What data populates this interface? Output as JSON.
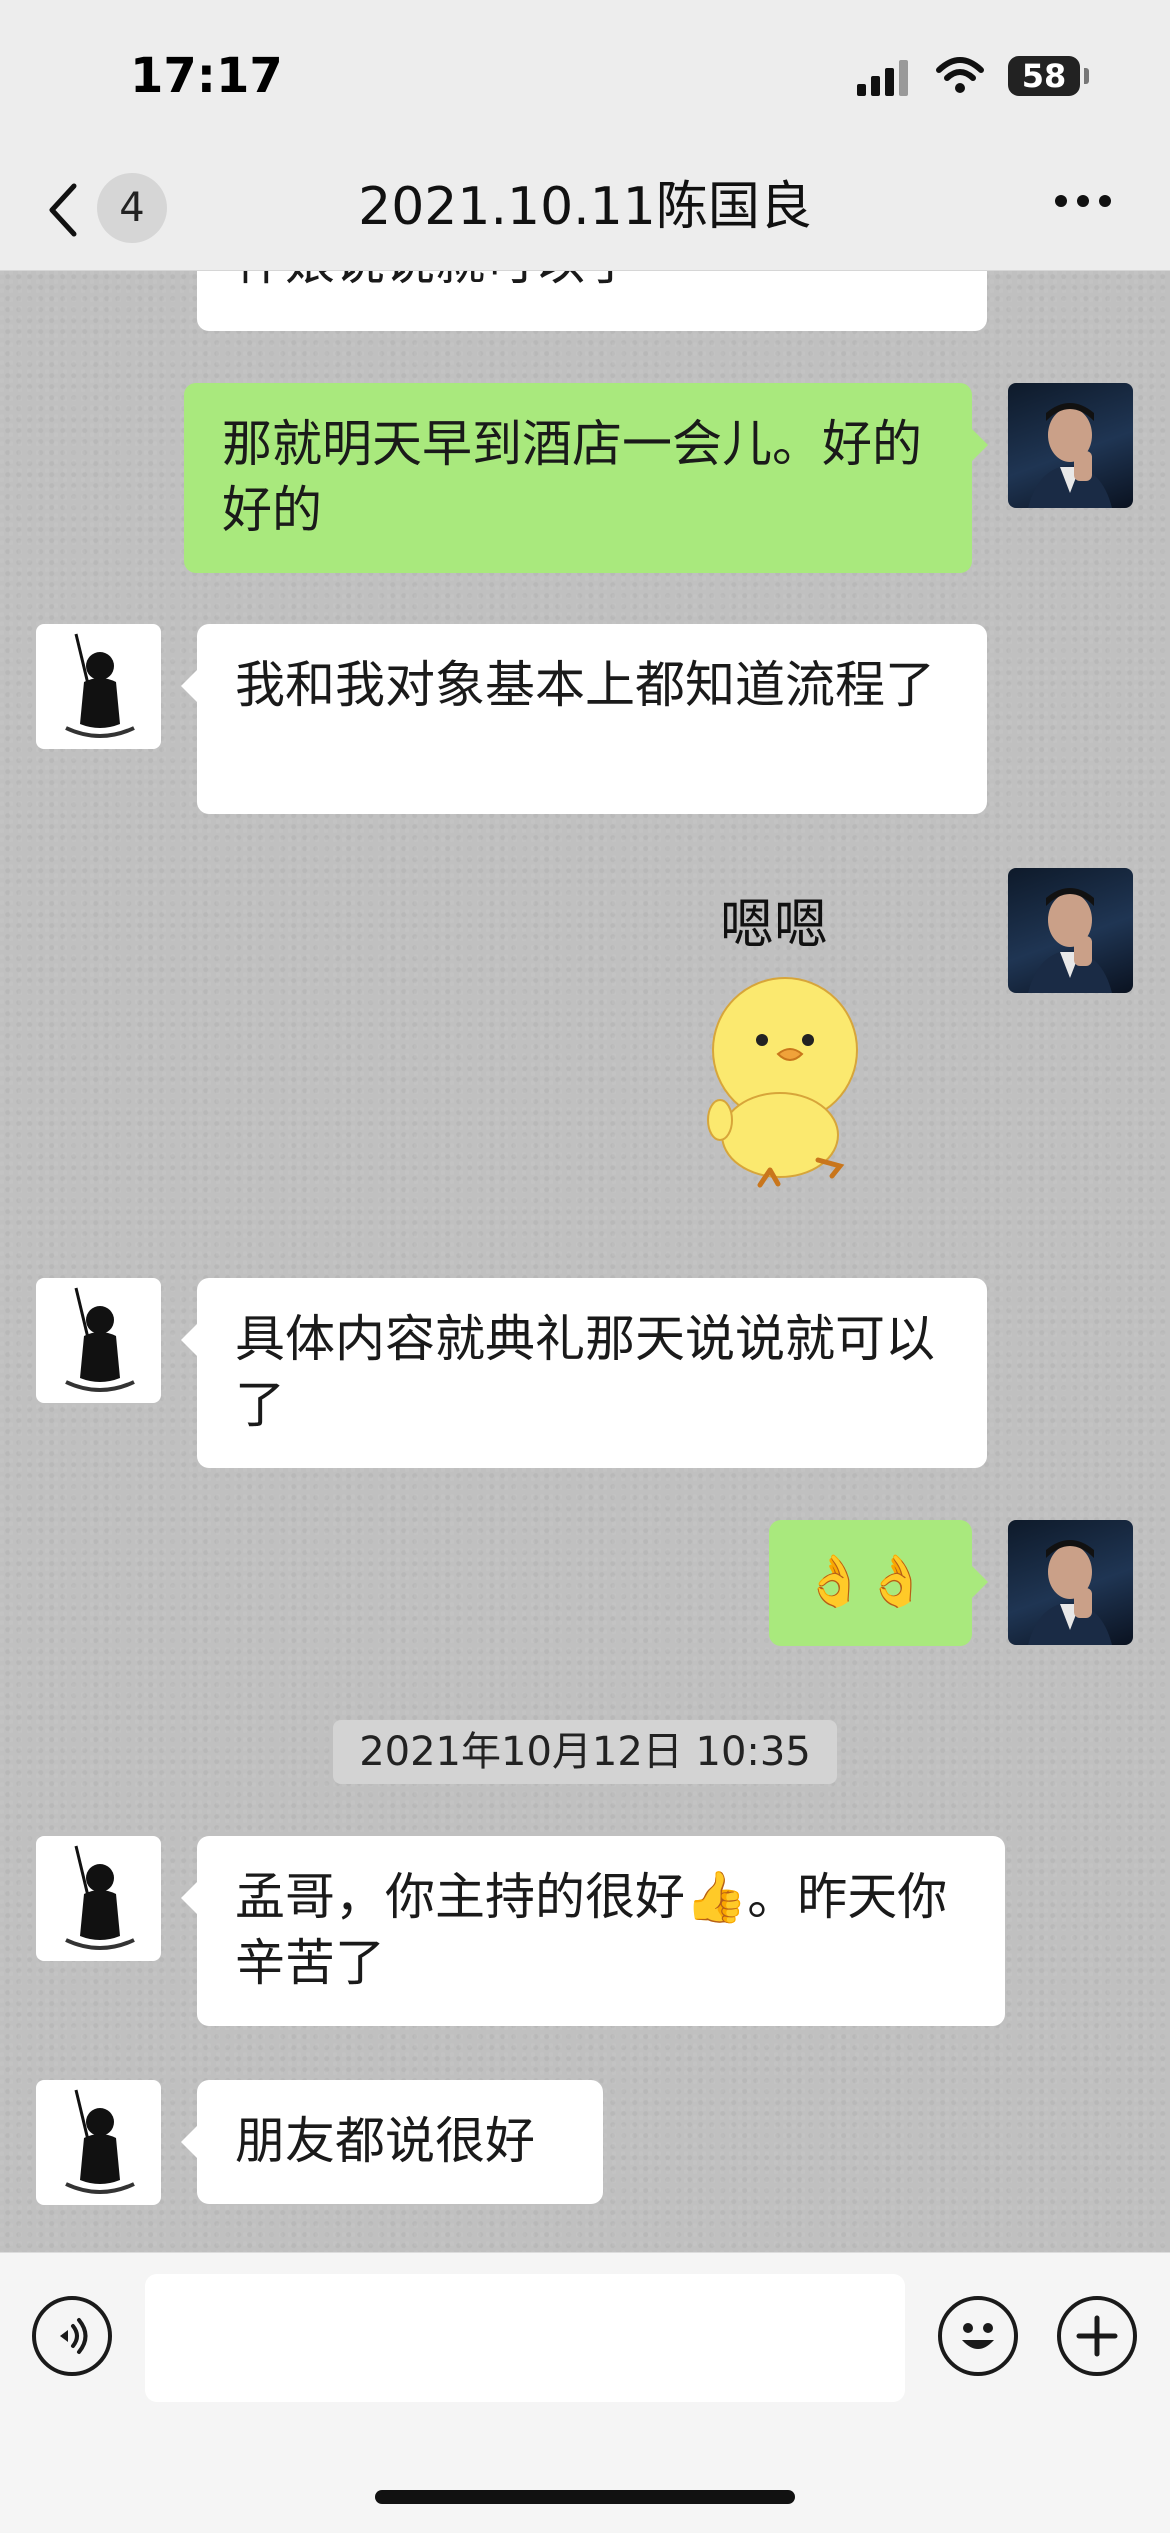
{
  "status_bar": {
    "time": "17:17",
    "battery": "58"
  },
  "nav": {
    "back_count": "4",
    "title": "2021.10.11陈国良"
  },
  "messages": {
    "m0": "伴娘说说就可以了",
    "m1": "那就明天早到酒店一会儿。好的好的",
    "m2": "我和我对象基本上都知道流程了",
    "m3_sticker_text": "嗯嗯",
    "m4": "具体内容就典礼那天说说就可以了",
    "m5": "👌👌",
    "timestamp": "2021年10月12日 10:35",
    "m6": "孟哥，你主持的很好👍。昨天你辛苦了",
    "m7": "朋友都说很好"
  },
  "colors": {
    "green_bubble": "#a9e97d",
    "white_bubble": "#ffffff",
    "nav_bg": "#ededed"
  },
  "icons": [
    "back-chevron-icon",
    "more-icon",
    "voice-icon",
    "emoji-icon",
    "plus-icon",
    "duck-sticker"
  ]
}
